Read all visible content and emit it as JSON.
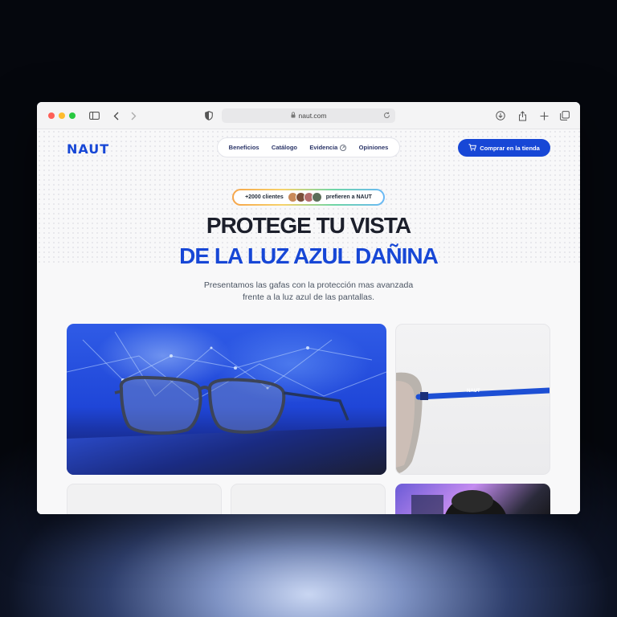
{
  "browser": {
    "url": "naut.com"
  },
  "header": {
    "logo": "NAUT",
    "nav": [
      {
        "label": "Beneficios"
      },
      {
        "label": "Catálogo"
      },
      {
        "label": "Evidencia"
      },
      {
        "label": "Opiniones"
      }
    ],
    "cta_label": "Comprar en la tienda"
  },
  "hero": {
    "badge_left": "+2000 clientes",
    "badge_right": "prefieren a NAUT",
    "title_line1": "PROTEGE TU VISTA",
    "title_line2": "DE LA LUZ AZUL DAÑINA",
    "subtitle_line1": "Presentamos las gafas con la protección mas avanzada",
    "subtitle_line2": "frente a la luz azul de las pantallas.",
    "temple_brand": "NAUT"
  },
  "colors": {
    "accent": "#1747d6",
    "heading": "#1c1f2b"
  }
}
